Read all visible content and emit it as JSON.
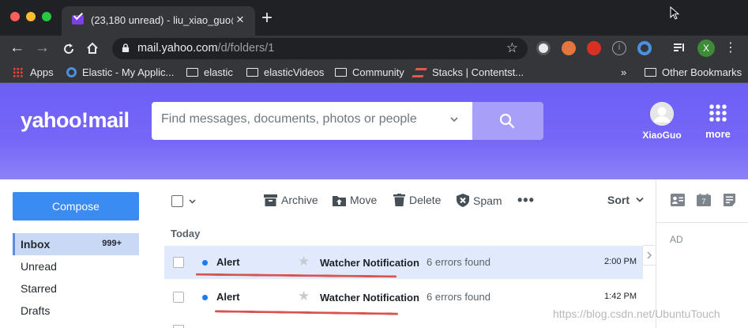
{
  "browser": {
    "tab_title": "(23,180 unread) - liu_xiao_guo@",
    "tab_close": "×",
    "new_tab": "+",
    "url_host": "mail.yahoo.com",
    "url_path": "/d/folders/1",
    "profile_initial": "X",
    "bookmarks": [
      {
        "label": "Apps",
        "icon": "apps-grid-icon"
      },
      {
        "label": "Elastic - My Applic...",
        "icon": "elastic-logo-icon"
      },
      {
        "label": "elastic",
        "icon": "folder-icon"
      },
      {
        "label": "elasticVideos",
        "icon": "folder-icon"
      },
      {
        "label": "Community",
        "icon": "folder-icon"
      },
      {
        "label": "Stacks | Contentst...",
        "icon": "contentstack-logo-icon"
      },
      {
        "label": "»",
        "icon": ""
      },
      {
        "label": "Other Bookmarks",
        "icon": "folder-icon"
      }
    ]
  },
  "header": {
    "logo": "yahoo!mail",
    "search_placeholder": "Find messages, documents, photos or people",
    "user_name": "XiaoGuo",
    "more_label": "more"
  },
  "sidebar": {
    "compose_label": "Compose",
    "folders": [
      {
        "label": "Inbox",
        "count": "999+",
        "active": true
      },
      {
        "label": "Unread",
        "count": "",
        "active": false
      },
      {
        "label": "Starred",
        "count": "",
        "active": false
      },
      {
        "label": "Drafts",
        "count": "",
        "active": false
      }
    ]
  },
  "toolbar": {
    "archive": "Archive",
    "move": "Move",
    "delete": "Delete",
    "spam": "Spam",
    "more": "•••",
    "sort": "Sort"
  },
  "list": {
    "group_label": "Today",
    "messages": [
      {
        "sender": "Alert",
        "subject": "Watcher Notification",
        "snippet": "6 errors found",
        "time": "2:00 PM",
        "unread": true,
        "selected": true
      },
      {
        "sender": "Alert",
        "subject": "Watcher Notification",
        "snippet": "6 errors found",
        "time": "1:42 PM",
        "unread": true,
        "selected": false
      }
    ]
  },
  "right_rail": {
    "ad_label": "AD"
  },
  "watermark": "https://blog.csdn.net/UbuntuTouch",
  "colors": {
    "header_purple": "#6d5ff5",
    "compose_blue": "#3a8bf2",
    "selected_row": "#e0eafc",
    "unread_dot": "#1d7bf0",
    "annotation_red": "#d9534f"
  }
}
